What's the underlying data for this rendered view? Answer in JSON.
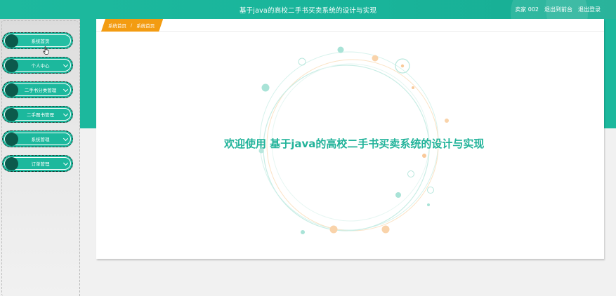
{
  "header": {
    "title": "基于java的高校二手书买卖系统的设计与实现",
    "user_label": "卖家 002",
    "exit_admin_label": "退出到前台",
    "logout_label": "退出登录"
  },
  "sidebar": {
    "items": [
      {
        "label": "系统首页",
        "has_chevron": false,
        "active": true
      },
      {
        "label": "个人中心",
        "has_chevron": true
      },
      {
        "label": "二手书分类管理",
        "has_chevron": true
      },
      {
        "label": "二手图书管理",
        "has_chevron": true
      },
      {
        "label": "系统管理",
        "has_chevron": true
      },
      {
        "label": "订单管理",
        "has_chevron": true
      }
    ]
  },
  "breadcrumb": {
    "home": "系统首页",
    "separator": "/",
    "current": "系统首页"
  },
  "main": {
    "welcome_text": "欢迎使用 基于java的高校二手书买卖系统的设计与实现"
  },
  "colors": {
    "primary": "#1cb89d",
    "accent": "#f39c12",
    "menu_dot": "#0c5a4c"
  }
}
